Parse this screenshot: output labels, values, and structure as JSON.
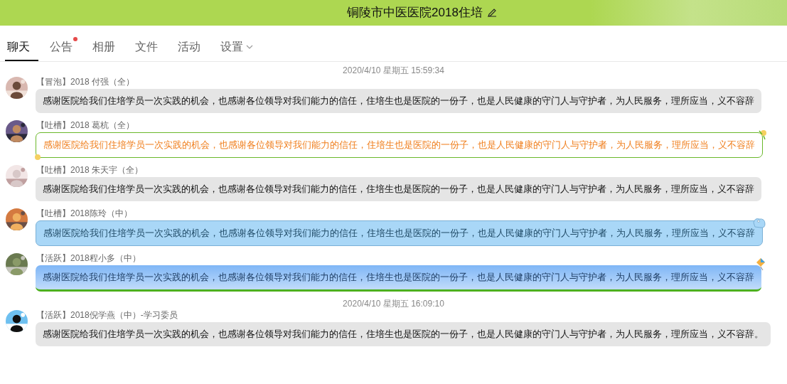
{
  "header": {
    "title": "铜陵市中医医院2018住培"
  },
  "tabs": [
    {
      "label": "聊天",
      "selected": true,
      "dot": false,
      "dropdown": false
    },
    {
      "label": "公告",
      "selected": false,
      "dot": true,
      "dropdown": false
    },
    {
      "label": "相册",
      "selected": false,
      "dot": false,
      "dropdown": false
    },
    {
      "label": "文件",
      "selected": false,
      "dot": false,
      "dropdown": false
    },
    {
      "label": "活动",
      "selected": false,
      "dot": false,
      "dropdown": false
    },
    {
      "label": "设置",
      "selected": false,
      "dot": false,
      "dropdown": true
    }
  ],
  "messages": [
    {
      "kind": "time",
      "text": "2020/4/10 星期五 15:59:34"
    },
    {
      "kind": "plain",
      "sender": "【冒泡】2018 付强（全）",
      "text": "感谢医院给我们住培学员一次实践的机会，也感谢各位领导对我们能力的信任，住培生也是医院的一份子，也是人民健康的守门人与守护者，为人民服务，理所应当，义不容辞"
    },
    {
      "kind": "flower",
      "sender": "【吐槽】2018 葛杭（全）",
      "text": "感谢医院给我们住培学员一次实践的机会，也感谢各位领导对我们能力的信任，住培生也是医院的一份子，也是人民健康的守门人与守护者，为人民服务，理所应当，义不容辞"
    },
    {
      "kind": "plain",
      "sender": "【吐槽】2018 朱天宇（全）",
      "text": "感谢医院给我们住培学员一次实践的机会，也感谢各位领导对我们能力的信任，住培生也是医院的一份子，也是人民健康的守门人与守护者，为人民服务，理所应当，义不容辞"
    },
    {
      "kind": "sky",
      "sender": "【吐槽】2018陈玲（中）",
      "text": "感谢医院给我们住培学员一次实践的机会，也感谢各位领导对我们能力的信任，住培生也是医院的一份子，也是人民健康的守门人与守护者，为人民服务，理所应当，义不容辞"
    },
    {
      "kind": "kite",
      "sender": "【活跃】2018程小多（中）",
      "text": "感谢医院给我们住培学员一次实践的机会，也感谢各位领导对我们能力的信任，住培生也是医院的一份子，也是人民健康的守门人与守护者，为人民服务，理所应当，义不容辞"
    },
    {
      "kind": "time",
      "text": "2020/4/10 星期五 16:09:10"
    },
    {
      "kind": "plain",
      "sender": "【活跃】2018倪学燕（中）-学习委员",
      "text": "感谢医院给我们住培学员一次实践的机会，也感谢各位领导对我们能力的信任，住培生也是医院的一份子，也是人民健康的守门人与守护者，为人民服务，理所应当，义不容辞。"
    }
  ]
}
